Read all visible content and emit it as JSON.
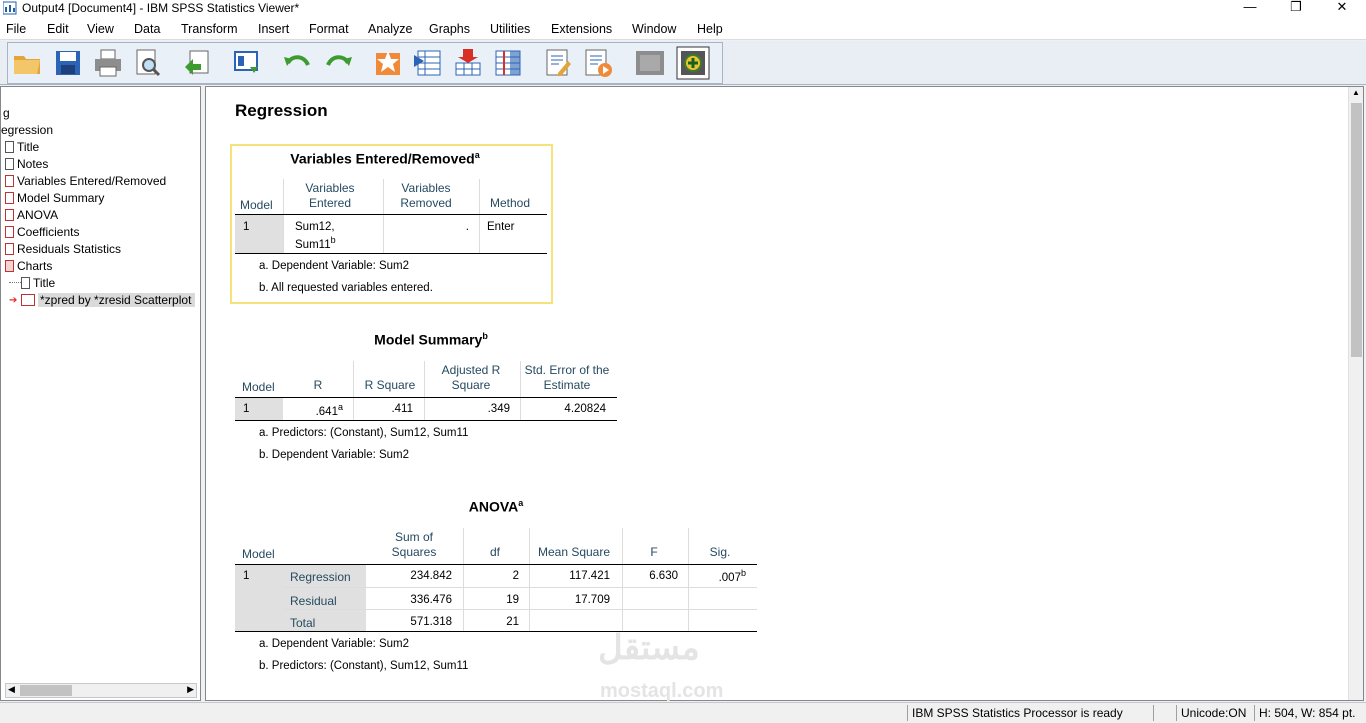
{
  "window": {
    "title": "Output4 [Document4] - IBM SPSS Statistics Viewer*",
    "minimize": "—",
    "restore": "❐",
    "close": "✕"
  },
  "menu": [
    "File",
    "Edit",
    "View",
    "Data",
    "Transform",
    "Insert",
    "Format",
    "Analyze",
    "Graphs",
    "Utilities",
    "Extensions",
    "Window",
    "Help"
  ],
  "toolbar_icons": [
    "open-icon",
    "save-icon",
    "print-icon",
    "print-preview-icon",
    "export-icon",
    "recall-dialog-icon",
    "undo-icon",
    "redo-icon",
    "goto-data-icon",
    "goto-case-icon",
    "goto-variable-icon",
    "variables-icon",
    "insert-output-icon",
    "run-script-icon",
    "designate-window-icon",
    "add-icon"
  ],
  "outline": {
    "items": [
      {
        "label": "g"
      },
      {
        "label": "egression"
      },
      {
        "label": "Title"
      },
      {
        "label": "Notes"
      },
      {
        "label": "Variables Entered/Removed"
      },
      {
        "label": "Model Summary"
      },
      {
        "label": "ANOVA"
      },
      {
        "label": "Coefficients"
      },
      {
        "label": "Residuals Statistics"
      },
      {
        "label": "Charts"
      },
      {
        "label": "Title"
      },
      {
        "label": "*zpred by *zresid Scatterplot"
      }
    ]
  },
  "content": {
    "heading": "Regression",
    "ver": {
      "title": "Variables Entered/Removed",
      "title_sup": "a",
      "headers": [
        "Model",
        "Variables Entered",
        "Variables Removed",
        "Method"
      ],
      "row": {
        "model": "1",
        "entered_line1": "Sum12,",
        "entered_line2": "Sum11",
        "entered_sup": "b",
        "removed": ".",
        "method": "Enter"
      },
      "footnotes": [
        "a. Dependent Variable: Sum2",
        "b. All requested variables entered."
      ]
    },
    "ms": {
      "title": "Model Summary",
      "title_sup": "b",
      "headers": [
        "Model",
        "R",
        "R Square",
        "Adjusted R Square",
        "Std. Error of the Estimate"
      ],
      "row": {
        "model": "1",
        "r": ".641",
        "r_sup": "a",
        "r2": ".411",
        "adj": ".349",
        "se": "4.20824"
      },
      "footnotes": [
        "a. Predictors: (Constant), Sum12, Sum11",
        "b. Dependent Variable: Sum2"
      ]
    },
    "anova": {
      "title": "ANOVA",
      "title_sup": "a",
      "headers": [
        "Model",
        "",
        "Sum of Squares",
        "df",
        "Mean Square",
        "F",
        "Sig."
      ],
      "model": "1",
      "rows": [
        {
          "label": "Regression",
          "ss": "234.842",
          "df": "2",
          "ms": "117.421",
          "f": "6.630",
          "sig": ".007",
          "sig_sup": "b"
        },
        {
          "label": "Residual",
          "ss": "336.476",
          "df": "19",
          "ms": "17.709",
          "f": "",
          "sig": ""
        },
        {
          "label": "Total",
          "ss": "571.318",
          "df": "21",
          "ms": "",
          "f": "",
          "sig": ""
        }
      ],
      "footnotes": [
        "a. Dependent Variable: Sum2",
        "b. Predictors: (Constant), Sum12, Sum11"
      ]
    }
  },
  "status": {
    "processor": "IBM SPSS Statistics Processor is ready",
    "unicode": "Unicode:ON",
    "size": "H: 504, W: 854 pt."
  },
  "watermark": {
    "arabic": "مستقل",
    "latin": "mostaql.com"
  }
}
